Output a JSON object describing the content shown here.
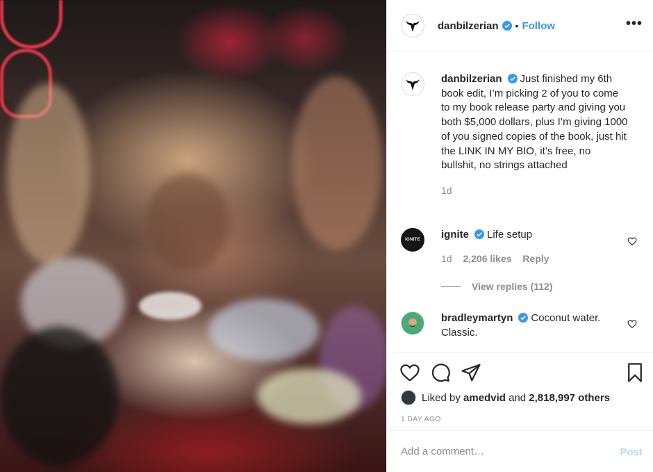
{
  "post": {
    "author": "danbilzerian",
    "separator": "•",
    "follow_label": "Follow",
    "more_label": "•••",
    "caption": {
      "username": "danbilzerian",
      "text": "Just finished my 6th book edit, I’m picking 2 of you to come to my book release party and giving you both $5,000 dollars, plus I’m giving 1000 of you signed copies of the book, just hit the LINK IN MY BIO, it’s free, no bullshit, no strings attached",
      "age": "1d"
    },
    "comments": [
      {
        "username": "ignite",
        "avatar_text": "IGNITE",
        "text": "Life setup",
        "age": "1d",
        "likes": "2,206 likes",
        "reply_label": "Reply",
        "view_replies": "View replies (112)"
      },
      {
        "username": "bradleymartyn",
        "text": "Coconut water. Classic."
      }
    ],
    "liked_by": {
      "prefix": "Liked by",
      "user": "amedvid",
      "middle": "and",
      "count": "2,818,997 others"
    },
    "date": "1 DAY AGO",
    "add_comment_placeholder": "Add a comment…",
    "post_button": "Post",
    "colors": {
      "link": "#3897f0",
      "post_disabled": "#b3dbff",
      "muted": "#8e8e8e",
      "text": "#262626",
      "verified": "#3897f0"
    },
    "icons": [
      "heart-icon",
      "comment-icon",
      "share-icon",
      "bookmark-icon",
      "verified-icon",
      "more-icon"
    ]
  }
}
